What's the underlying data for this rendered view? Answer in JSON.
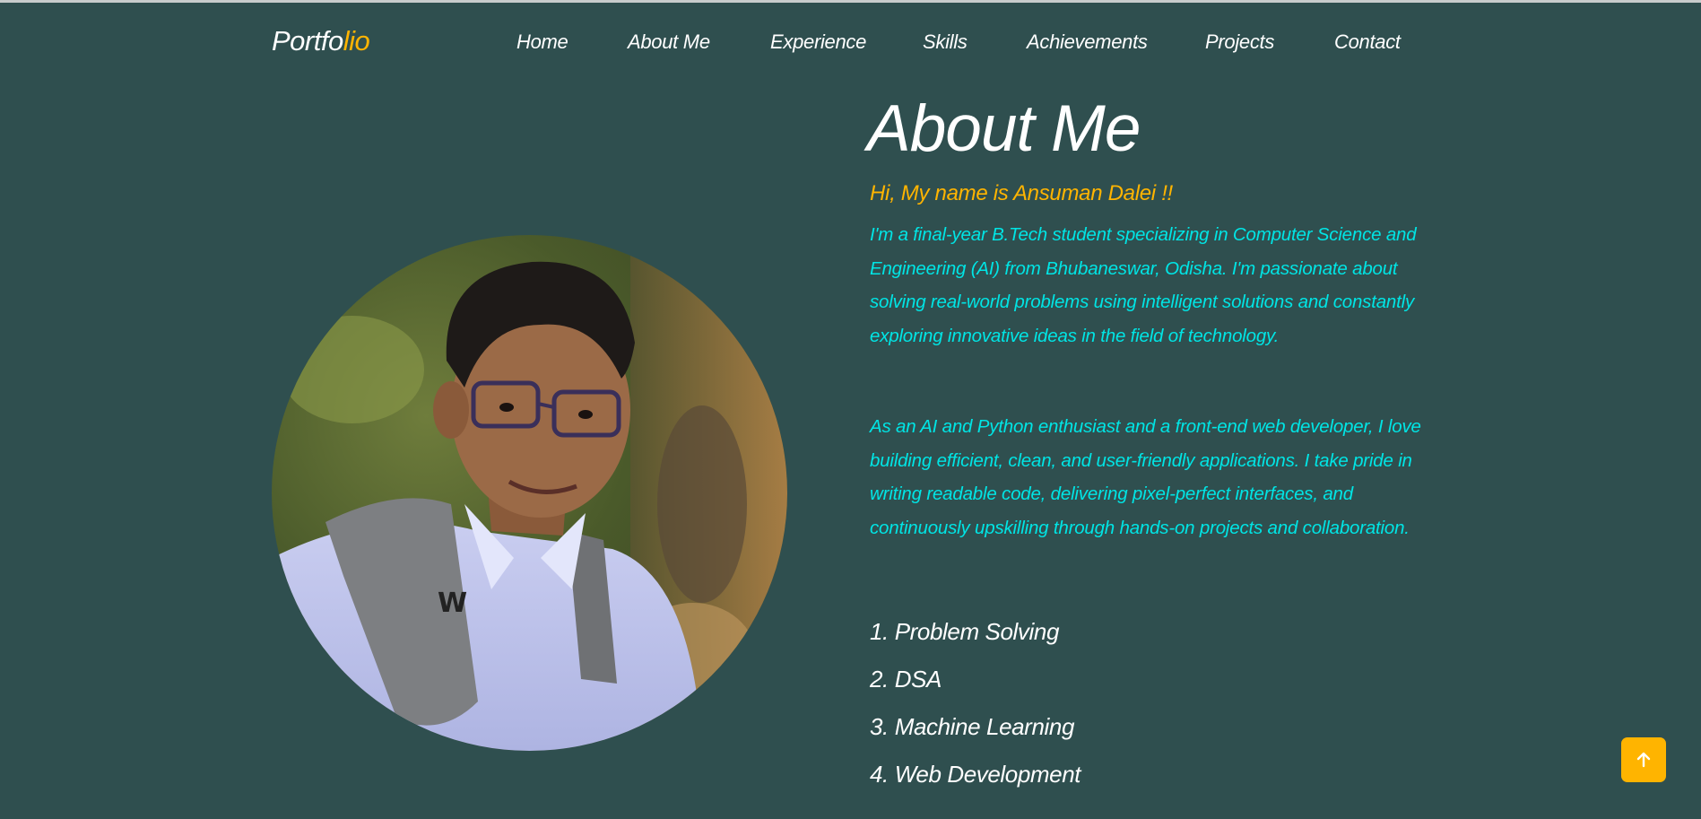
{
  "logo": {
    "main": "Portfo",
    "accent": "lio"
  },
  "nav": {
    "items": [
      "Home",
      "About Me",
      "Experience",
      "Skills",
      "Achievements",
      "Projects",
      "Contact"
    ]
  },
  "about": {
    "title": "About Me",
    "greeting": "Hi, My name is Ansuman Dalei !!",
    "paragraph1": "I'm a final-year B.Tech student specializing in Computer Science and Engineering (AI) from Bhubaneswar, Odisha. I'm passionate about solving real-world problems using intelligent solutions and constantly exploring innovative ideas in the field of technology.",
    "paragraph2": "As an AI and Python enthusiast and a front-end web developer, I love building efficient, clean, and user-friendly applications. I take pride in writing readable code, delivering pixel-perfect interfaces, and continuously upskilling through hands-on projects and collaboration.",
    "skills": [
      "1. Problem Solving",
      "2. DSA",
      "3. Machine Learning",
      "4. Web Development"
    ]
  },
  "icons": {
    "scroll_top": "arrow-up-icon",
    "photo": "profile-photo"
  },
  "colors": {
    "background": "#2f4f4f",
    "accent": "#ffb400",
    "paragraph": "#00e5e5",
    "text": "#ffffff"
  }
}
